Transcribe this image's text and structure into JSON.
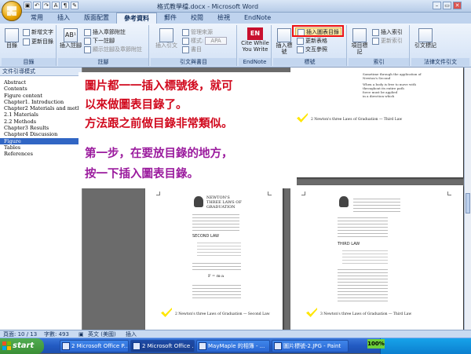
{
  "window": {
    "title": "格式教學檔.docx - Microsoft Word",
    "controls": {
      "min": "–",
      "max": "▭",
      "close": "✕"
    }
  },
  "qat": [
    "▣",
    "↶",
    "↷",
    "A",
    "¶",
    "✎"
  ],
  "tabs": [
    "常用",
    "插入",
    "版面配置",
    "參考資料",
    "郵件",
    "校閱",
    "檢視",
    "EndNote"
  ],
  "active_tab": "參考資料",
  "ribbon": {
    "toc": {
      "big": "目錄",
      "add_text": "新增文字",
      "update": "更新目錄",
      "label": "目錄"
    },
    "footnotes": {
      "insert": "插入註腳",
      "insert_endnote": "插入章節附註",
      "next": "下一註腳",
      "show": "顯示註腳及章節附註",
      "label": "註腳"
    },
    "citations": {
      "big": "插入引文",
      "manage": "管理來源",
      "style_label": "樣式:",
      "style_value": "APA",
      "bibliography": "書目",
      "label": "引文與書目"
    },
    "endnote": {
      "big": "Cite While You Write",
      "label": "EndNote"
    },
    "captions": {
      "insert_caption": "插入標號",
      "insert_tof": "插入圖表目錄",
      "update_table": "更新表格",
      "cross_ref": "交互參照",
      "label": "標號"
    },
    "index": {
      "mark_entry": "項目標記",
      "insert_index": "插入索引",
      "update_index": "更新索引",
      "label": "索引"
    },
    "toa": {
      "mark_citation": "引文標記",
      "label": "法律文件引文"
    }
  },
  "nav": {
    "header": "文件引導模式",
    "items": [
      "Abstract",
      "Contents",
      "Figure content",
      "Chapter1. Introduction",
      "Chapter2 Materials and methods",
      "2.1 Materials",
      "2.2 Methods",
      "Chapter3 Results",
      "Chapter4 Discussion",
      "Figure",
      "Tables",
      "References"
    ],
    "selected": "Figure"
  },
  "callout": {
    "lines_red": [
      "圖片都一一插入標號後，就可",
      "以來做圖表目錄了。",
      "方法跟之前做目錄非常類似。"
    ],
    "lines_purple": [
      "第一步，在要放目錄的地方，",
      "按一下插入圖表目錄。"
    ]
  },
  "pages": {
    "top_right_caption": "2  Newton's three Laws of Graduation — Third Law",
    "bottom_left_caption": "2  Newton's three Laws of Graduation — Second Law",
    "bottom_right_caption": "3  Newton's three Laws of Graduation — Third Law",
    "book_title_lines": [
      "NEWTON'S",
      "THREE LAWS OF",
      "GRADUATION"
    ],
    "second_law": "SECOND LAW",
    "third_law": "THIRD LAW",
    "formula": "F = m·a",
    "sample_lines": [
      "Sometime through the application of",
      "Newton's Second",
      "When a body is free to move with",
      "throughout its entire path",
      "force must be applied",
      "in a direction which"
    ]
  },
  "status": {
    "page": "頁面: 10 / 13",
    "words": "字數: 493",
    "lang": "英文 (美國)",
    "insert": "插入"
  },
  "taskbar": {
    "start": "start",
    "tasks": [
      "2 Microsoft Office P...",
      "2 Microsoft Office ...",
      "MayMaple 的相簿 - ...",
      "圖片標號-2.JPG - Paint"
    ],
    "zoom": "100%"
  },
  "colors": {
    "callout_red": "#d10a1e",
    "callout_purple": "#9b1c9e",
    "highlight_box": "#e11111"
  }
}
